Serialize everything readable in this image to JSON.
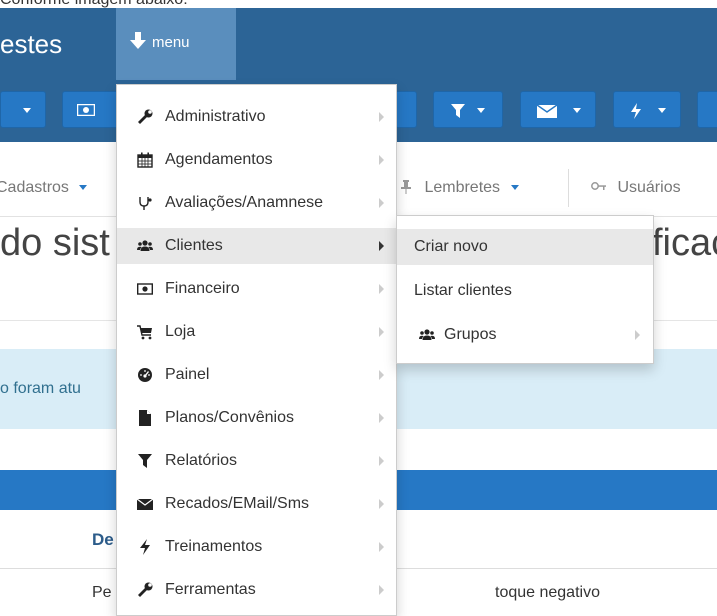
{
  "caption": "Conforme imagem abaixo:",
  "navbar": {
    "brand": "estes",
    "menu_label": "menu"
  },
  "secbar": {
    "cadastros": "Cadastros",
    "lembretes": "Lembretes",
    "usuarios": "Usuários"
  },
  "page": {
    "title_left": "do sist",
    "title_right": "ficac",
    "alert_text": "o foram atu",
    "table_header": "De",
    "cell_left": "Pe",
    "cell_right": "toque negativo"
  },
  "menu": {
    "items": [
      {
        "label": "Administrativo",
        "icon": "wrench-icon"
      },
      {
        "label": "Agendamentos",
        "icon": "calendar-icon"
      },
      {
        "label": "Avaliações/Anamnese",
        "icon": "stethoscope-icon"
      },
      {
        "label": "Clientes",
        "icon": "users-icon"
      },
      {
        "label": "Financeiro",
        "icon": "money-icon"
      },
      {
        "label": "Loja",
        "icon": "cart-icon"
      },
      {
        "label": "Painel",
        "icon": "dashboard-icon"
      },
      {
        "label": "Planos/Convênios",
        "icon": "file-icon"
      },
      {
        "label": "Relatórios",
        "icon": "filter-icon"
      },
      {
        "label": "Recados/EMail/Sms",
        "icon": "envelope-icon"
      },
      {
        "label": "Treinamentos",
        "icon": "bolt-icon"
      },
      {
        "label": "Ferramentas",
        "icon": "wrench-icon"
      }
    ],
    "active_index": 3
  },
  "submenu": {
    "items": [
      {
        "label": "Criar novo"
      },
      {
        "label": "Listar clientes"
      },
      {
        "label": "Grupos",
        "icon": "users-icon"
      }
    ]
  },
  "colors": {
    "navbar": "#2c6496",
    "menu_active": "#5a8ebd",
    "button": "#2678c5",
    "alert": "#d9edf7"
  }
}
